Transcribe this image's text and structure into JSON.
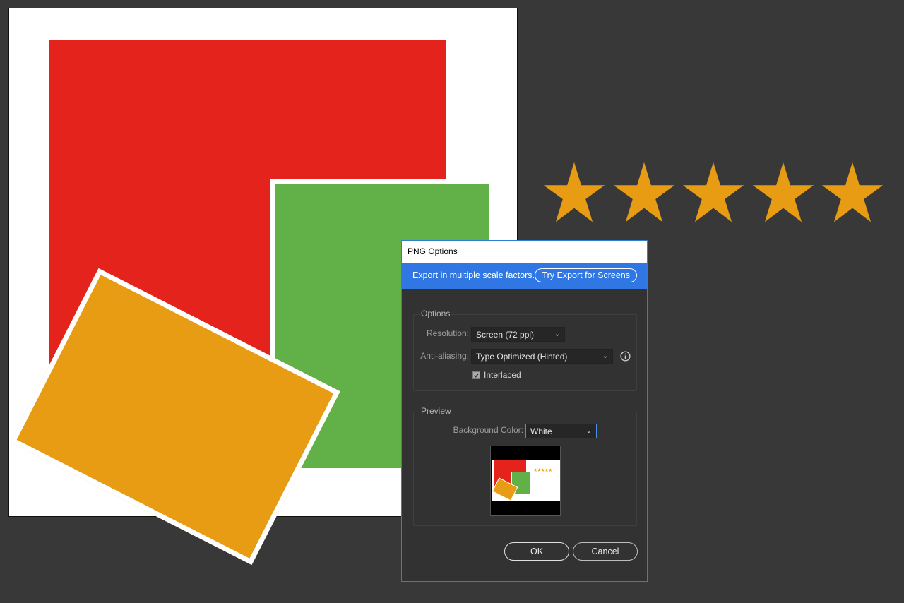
{
  "artwork": {
    "colors": {
      "red": "#e3231c",
      "green": "#61b148",
      "orange": "#e89c13",
      "stars": "#e89c13"
    },
    "rating": {
      "stars_filled": 5,
      "stars_total": 5
    }
  },
  "dialog": {
    "title": "PNG Options",
    "banner": {
      "text": "Export in multiple scale factors.",
      "button_label": "Try Export for Screens"
    },
    "options": {
      "group_title": "Options",
      "resolution_label": "Resolution:",
      "resolution_value": "Screen (72 ppi)",
      "antialiasing_label": "Anti-aliasing:",
      "antialiasing_value": "Type Optimized (Hinted)",
      "info_icon": "info-icon",
      "interlaced_label": "Interlaced",
      "interlaced_checked": true
    },
    "preview": {
      "group_title": "Preview",
      "background_color_label": "Background Color:",
      "background_color_value": "White",
      "thumbnail_stars": "★★★★★"
    },
    "buttons": {
      "ok": "OK",
      "cancel": "Cancel"
    }
  }
}
